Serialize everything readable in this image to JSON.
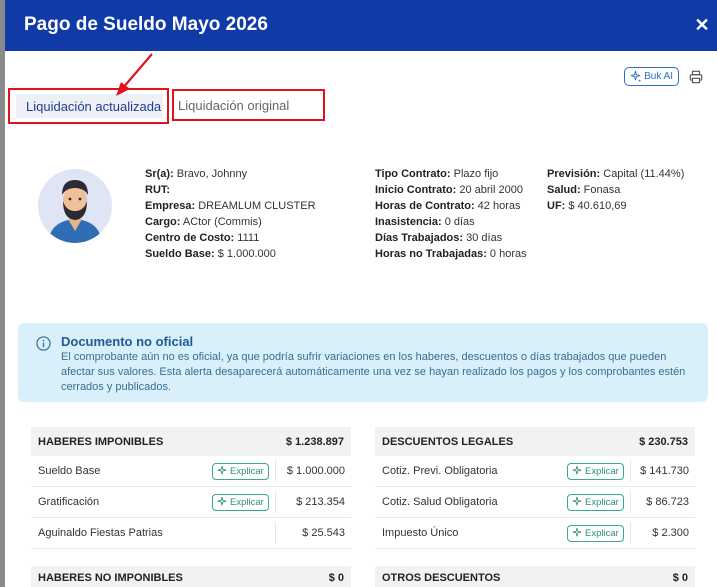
{
  "modal": {
    "title": "Pago de Sueldo Mayo 2026"
  },
  "toolbar": {
    "buk_ai_label": "Buk AI"
  },
  "tabs": [
    {
      "label": "Liquidación actualizada",
      "active": true
    },
    {
      "label": "Liquidación original",
      "active": false
    }
  ],
  "employee": {
    "col1": [
      {
        "label": "Sr(a):",
        "value": " Bravo, Johnny"
      },
      {
        "label": "RUT:",
        "value": ""
      },
      {
        "label": "Empresa:",
        "value": " DREAMLUM CLUSTER"
      },
      {
        "label": "Cargo:",
        "value": " ACtor (Commis)"
      },
      {
        "label": "Centro de Costo:",
        "value": " 1111"
      },
      {
        "label": "Sueldo Base:",
        "value": " $ 1.000.000"
      }
    ],
    "col2": [
      {
        "label": "Tipo Contrato:",
        "value": " Plazo fijo"
      },
      {
        "label": "Inicio Contrato:",
        "value": " 20 abril 2000"
      },
      {
        "label": "Horas de Contrato:",
        "value": " 42 horas"
      },
      {
        "label": "Inasistencia:",
        "value": " 0 días"
      },
      {
        "label": "Días Trabajados:",
        "value": " 30 días"
      },
      {
        "label": "Horas no Trabajadas:",
        "value": " 0 horas"
      }
    ],
    "col3": [
      {
        "label": "Previsión:",
        "value": " Capital (11.44%)"
      },
      {
        "label": "Salud:",
        "value": " Fonasa"
      },
      {
        "label": "UF:",
        "value": " $ 40.610,69"
      }
    ]
  },
  "alert": {
    "title": "Documento no oficial",
    "message": "El comprobante aún no es oficial, ya que podría sufrir variaciones en los haberes, descuentos o días trabajados que pueden afectar sus valores. Esta alerta desaparecerá automáticamente una vez se hayan realizado los pagos y los comprobantes estén cerrados y publicados."
  },
  "haberes_imponibles": {
    "title": "HABERES IMPONIBLES",
    "total": "$ 1.238.897",
    "rows": [
      {
        "name": "Sueldo Base",
        "explain": "Explicar",
        "amount": "$ 1.000.000"
      },
      {
        "name": "Gratificación",
        "explain": "Explicar",
        "amount": "$ 213.354"
      },
      {
        "name": "Aguinaldo Fiestas Patrias",
        "explain": "",
        "amount": "$ 25.543"
      }
    ]
  },
  "descuentos_legales": {
    "title": "DESCUENTOS LEGALES",
    "total": "$ 230.753",
    "rows": [
      {
        "name": "Cotiz. Previ. Obligatoria",
        "explain": "Explicar",
        "amount": "$ 141.730"
      },
      {
        "name": "Cotiz. Salud Obligatoria",
        "explain": "Explicar",
        "amount": "$ 86.723"
      },
      {
        "name": "Impuesto Único",
        "explain": "Explicar",
        "amount": "$ 2.300"
      }
    ]
  },
  "haberes_no_imponibles": {
    "title": "HABERES NO IMPONIBLES",
    "total": "$ 0"
  },
  "otros_descuentos": {
    "title": "OTROS DESCUENTOS",
    "total": "$ 0"
  },
  "colors": {
    "header": "#0f3aa8",
    "highlight": "#e0121d",
    "alert_bg": "#d9f0fb",
    "explain": "#39a98f"
  }
}
